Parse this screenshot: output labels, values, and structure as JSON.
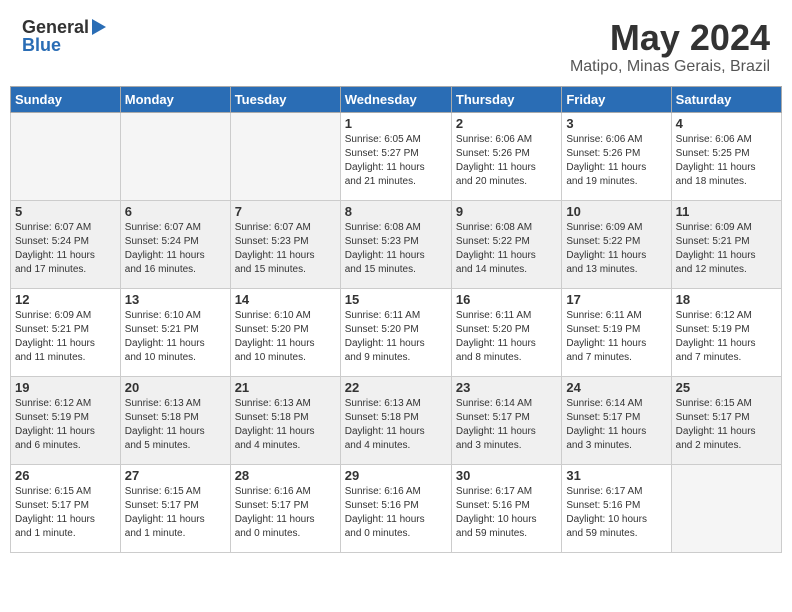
{
  "header": {
    "logo_general": "General",
    "logo_blue": "Blue",
    "month_title": "May 2024",
    "location": "Matipo, Minas Gerais, Brazil"
  },
  "weekdays": [
    "Sunday",
    "Monday",
    "Tuesday",
    "Wednesday",
    "Thursday",
    "Friday",
    "Saturday"
  ],
  "weeks": [
    [
      {
        "day": "",
        "info": ""
      },
      {
        "day": "",
        "info": ""
      },
      {
        "day": "",
        "info": ""
      },
      {
        "day": "1",
        "info": "Sunrise: 6:05 AM\nSunset: 5:27 PM\nDaylight: 11 hours\nand 21 minutes."
      },
      {
        "day": "2",
        "info": "Sunrise: 6:06 AM\nSunset: 5:26 PM\nDaylight: 11 hours\nand 20 minutes."
      },
      {
        "day": "3",
        "info": "Sunrise: 6:06 AM\nSunset: 5:26 PM\nDaylight: 11 hours\nand 19 minutes."
      },
      {
        "day": "4",
        "info": "Sunrise: 6:06 AM\nSunset: 5:25 PM\nDaylight: 11 hours\nand 18 minutes."
      }
    ],
    [
      {
        "day": "5",
        "info": "Sunrise: 6:07 AM\nSunset: 5:24 PM\nDaylight: 11 hours\nand 17 minutes."
      },
      {
        "day": "6",
        "info": "Sunrise: 6:07 AM\nSunset: 5:24 PM\nDaylight: 11 hours\nand 16 minutes."
      },
      {
        "day": "7",
        "info": "Sunrise: 6:07 AM\nSunset: 5:23 PM\nDaylight: 11 hours\nand 15 minutes."
      },
      {
        "day": "8",
        "info": "Sunrise: 6:08 AM\nSunset: 5:23 PM\nDaylight: 11 hours\nand 15 minutes."
      },
      {
        "day": "9",
        "info": "Sunrise: 6:08 AM\nSunset: 5:22 PM\nDaylight: 11 hours\nand 14 minutes."
      },
      {
        "day": "10",
        "info": "Sunrise: 6:09 AM\nSunset: 5:22 PM\nDaylight: 11 hours\nand 13 minutes."
      },
      {
        "day": "11",
        "info": "Sunrise: 6:09 AM\nSunset: 5:21 PM\nDaylight: 11 hours\nand 12 minutes."
      }
    ],
    [
      {
        "day": "12",
        "info": "Sunrise: 6:09 AM\nSunset: 5:21 PM\nDaylight: 11 hours\nand 11 minutes."
      },
      {
        "day": "13",
        "info": "Sunrise: 6:10 AM\nSunset: 5:21 PM\nDaylight: 11 hours\nand 10 minutes."
      },
      {
        "day": "14",
        "info": "Sunrise: 6:10 AM\nSunset: 5:20 PM\nDaylight: 11 hours\nand 10 minutes."
      },
      {
        "day": "15",
        "info": "Sunrise: 6:11 AM\nSunset: 5:20 PM\nDaylight: 11 hours\nand 9 minutes."
      },
      {
        "day": "16",
        "info": "Sunrise: 6:11 AM\nSunset: 5:20 PM\nDaylight: 11 hours\nand 8 minutes."
      },
      {
        "day": "17",
        "info": "Sunrise: 6:11 AM\nSunset: 5:19 PM\nDaylight: 11 hours\nand 7 minutes."
      },
      {
        "day": "18",
        "info": "Sunrise: 6:12 AM\nSunset: 5:19 PM\nDaylight: 11 hours\nand 7 minutes."
      }
    ],
    [
      {
        "day": "19",
        "info": "Sunrise: 6:12 AM\nSunset: 5:19 PM\nDaylight: 11 hours\nand 6 minutes."
      },
      {
        "day": "20",
        "info": "Sunrise: 6:13 AM\nSunset: 5:18 PM\nDaylight: 11 hours\nand 5 minutes."
      },
      {
        "day": "21",
        "info": "Sunrise: 6:13 AM\nSunset: 5:18 PM\nDaylight: 11 hours\nand 4 minutes."
      },
      {
        "day": "22",
        "info": "Sunrise: 6:13 AM\nSunset: 5:18 PM\nDaylight: 11 hours\nand 4 minutes."
      },
      {
        "day": "23",
        "info": "Sunrise: 6:14 AM\nSunset: 5:17 PM\nDaylight: 11 hours\nand 3 minutes."
      },
      {
        "day": "24",
        "info": "Sunrise: 6:14 AM\nSunset: 5:17 PM\nDaylight: 11 hours\nand 3 minutes."
      },
      {
        "day": "25",
        "info": "Sunrise: 6:15 AM\nSunset: 5:17 PM\nDaylight: 11 hours\nand 2 minutes."
      }
    ],
    [
      {
        "day": "26",
        "info": "Sunrise: 6:15 AM\nSunset: 5:17 PM\nDaylight: 11 hours\nand 1 minute."
      },
      {
        "day": "27",
        "info": "Sunrise: 6:15 AM\nSunset: 5:17 PM\nDaylight: 11 hours\nand 1 minute."
      },
      {
        "day": "28",
        "info": "Sunrise: 6:16 AM\nSunset: 5:17 PM\nDaylight: 11 hours\nand 0 minutes."
      },
      {
        "day": "29",
        "info": "Sunrise: 6:16 AM\nSunset: 5:16 PM\nDaylight: 11 hours\nand 0 minutes."
      },
      {
        "day": "30",
        "info": "Sunrise: 6:17 AM\nSunset: 5:16 PM\nDaylight: 10 hours\nand 59 minutes."
      },
      {
        "day": "31",
        "info": "Sunrise: 6:17 AM\nSunset: 5:16 PM\nDaylight: 10 hours\nand 59 minutes."
      },
      {
        "day": "",
        "info": ""
      }
    ]
  ]
}
